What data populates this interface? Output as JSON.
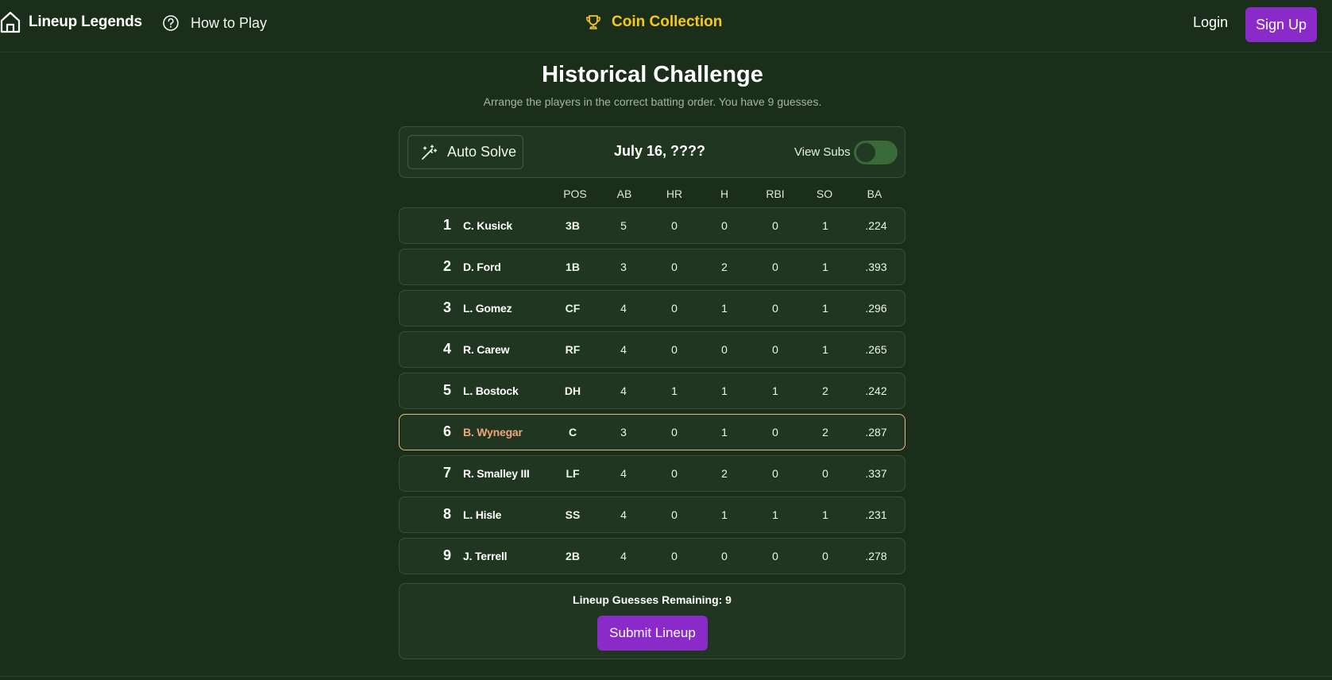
{
  "header": {
    "brand": "Lineup Legends",
    "how_to_play": "How to Play",
    "coin_collection": "Coin Collection",
    "login": "Login",
    "sign_up": "Sign Up"
  },
  "page": {
    "title": "Historical Challenge",
    "subtitle": "Arrange the players in the correct batting order. You have 9 guesses."
  },
  "controls": {
    "auto_solve": "Auto Solve",
    "date": "July 16, ????",
    "view_subs": "View Subs",
    "view_subs_on": false
  },
  "stat_headers": [
    "POS",
    "AB",
    "HR",
    "H",
    "RBI",
    "SO",
    "BA"
  ],
  "lineup": [
    {
      "order": "1",
      "name": "C. Kusick",
      "pos": "3B",
      "ab": "5",
      "hr": "0",
      "h": "0",
      "rbi": "0",
      "so": "1",
      "ba": ".224"
    },
    {
      "order": "2",
      "name": "D. Ford",
      "pos": "1B",
      "ab": "3",
      "hr": "0",
      "h": "2",
      "rbi": "0",
      "so": "1",
      "ba": ".393"
    },
    {
      "order": "3",
      "name": "L. Gomez",
      "pos": "CF",
      "ab": "4",
      "hr": "0",
      "h": "1",
      "rbi": "0",
      "so": "1",
      "ba": ".296"
    },
    {
      "order": "4",
      "name": "R. Carew",
      "pos": "RF",
      "ab": "4",
      "hr": "0",
      "h": "0",
      "rbi": "0",
      "so": "1",
      "ba": ".265"
    },
    {
      "order": "5",
      "name": "L. Bostock",
      "pos": "DH",
      "ab": "4",
      "hr": "1",
      "h": "1",
      "rbi": "1",
      "so": "2",
      "ba": ".242"
    },
    {
      "order": "6",
      "name": "B. Wynegar",
      "pos": "C",
      "ab": "3",
      "hr": "0",
      "h": "1",
      "rbi": "0",
      "so": "2",
      "ba": ".287",
      "selected": true
    },
    {
      "order": "7",
      "name": "R. Smalley III",
      "pos": "LF",
      "ab": "4",
      "hr": "0",
      "h": "2",
      "rbi": "0",
      "so": "0",
      "ba": ".337"
    },
    {
      "order": "8",
      "name": "L. Hisle",
      "pos": "SS",
      "ab": "4",
      "hr": "0",
      "h": "1",
      "rbi": "1",
      "so": "1",
      "ba": ".231"
    },
    {
      "order": "9",
      "name": "J. Terrell",
      "pos": "2B",
      "ab": "4",
      "hr": "0",
      "h": "0",
      "rbi": "0",
      "so": "0",
      "ba": ".278"
    }
  ],
  "footer": {
    "remaining_label": "Lineup Guesses Remaining: 9",
    "submit": "Submit Lineup"
  },
  "icons": {
    "brand": "home-icon",
    "how_to_play": "question-circle-icon",
    "coins": "trophy-icon",
    "auto_solve": "magic-wand-icon"
  },
  "colors": {
    "background": "#1a2e1a",
    "panel": "#203620",
    "accent": "#8a2bc9",
    "coin": "#f6c81a",
    "selected_border": "#e8b978",
    "selected_name": "#f0a37c"
  }
}
